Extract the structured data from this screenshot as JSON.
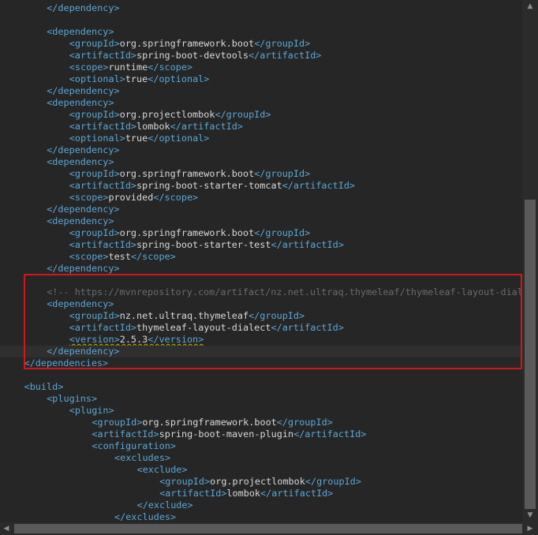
{
  "editor": {
    "lines": [
      {
        "indent": 2,
        "parts": [
          {
            "t": "tag",
            "v": "</dependency>"
          }
        ]
      },
      {
        "indent": 0,
        "parts": []
      },
      {
        "indent": 2,
        "parts": [
          {
            "t": "tag",
            "v": "<dependency>"
          }
        ]
      },
      {
        "indent": 3,
        "parts": [
          {
            "t": "tag",
            "v": "<groupId>"
          },
          {
            "t": "txt",
            "v": "org.springframework.boot"
          },
          {
            "t": "tag",
            "v": "</groupId>"
          }
        ]
      },
      {
        "indent": 3,
        "parts": [
          {
            "t": "tag",
            "v": "<artifactId>"
          },
          {
            "t": "txt",
            "v": "spring-boot-devtools"
          },
          {
            "t": "tag",
            "v": "</artifactId>"
          }
        ]
      },
      {
        "indent": 3,
        "parts": [
          {
            "t": "tag",
            "v": "<scope>"
          },
          {
            "t": "txt",
            "v": "runtime"
          },
          {
            "t": "tag",
            "v": "</scope>"
          }
        ]
      },
      {
        "indent": 3,
        "parts": [
          {
            "t": "tag",
            "v": "<optional>"
          },
          {
            "t": "txt",
            "v": "true"
          },
          {
            "t": "tag",
            "v": "</optional>"
          }
        ]
      },
      {
        "indent": 2,
        "parts": [
          {
            "t": "tag",
            "v": "</dependency>"
          }
        ]
      },
      {
        "indent": 2,
        "parts": [
          {
            "t": "tag",
            "v": "<dependency>"
          }
        ]
      },
      {
        "indent": 3,
        "parts": [
          {
            "t": "tag",
            "v": "<groupId>"
          },
          {
            "t": "txt",
            "v": "org.projectlombok"
          },
          {
            "t": "tag",
            "v": "</groupId>"
          }
        ]
      },
      {
        "indent": 3,
        "parts": [
          {
            "t": "tag",
            "v": "<artifactId>"
          },
          {
            "t": "txt",
            "v": "lombok"
          },
          {
            "t": "tag",
            "v": "</artifactId>"
          }
        ]
      },
      {
        "indent": 3,
        "parts": [
          {
            "t": "tag",
            "v": "<optional>"
          },
          {
            "t": "txt",
            "v": "true"
          },
          {
            "t": "tag",
            "v": "</optional>"
          }
        ]
      },
      {
        "indent": 2,
        "parts": [
          {
            "t": "tag",
            "v": "</dependency>"
          }
        ]
      },
      {
        "indent": 2,
        "parts": [
          {
            "t": "tag",
            "v": "<dependency>"
          }
        ]
      },
      {
        "indent": 3,
        "parts": [
          {
            "t": "tag",
            "v": "<groupId>"
          },
          {
            "t": "txt",
            "v": "org.springframework.boot"
          },
          {
            "t": "tag",
            "v": "</groupId>"
          }
        ]
      },
      {
        "indent": 3,
        "parts": [
          {
            "t": "tag",
            "v": "<artifactId>"
          },
          {
            "t": "txt",
            "v": "spring-boot-starter-tomcat"
          },
          {
            "t": "tag",
            "v": "</artifactId>"
          }
        ]
      },
      {
        "indent": 3,
        "parts": [
          {
            "t": "tag",
            "v": "<scope>"
          },
          {
            "t": "txt",
            "v": "provided"
          },
          {
            "t": "tag",
            "v": "</scope>"
          }
        ]
      },
      {
        "indent": 2,
        "parts": [
          {
            "t": "tag",
            "v": "</dependency>"
          }
        ]
      },
      {
        "indent": 2,
        "parts": [
          {
            "t": "tag",
            "v": "<dependency>"
          }
        ]
      },
      {
        "indent": 3,
        "parts": [
          {
            "t": "tag",
            "v": "<groupId>"
          },
          {
            "t": "txt",
            "v": "org.springframework.boot"
          },
          {
            "t": "tag",
            "v": "</groupId>"
          }
        ]
      },
      {
        "indent": 3,
        "parts": [
          {
            "t": "tag",
            "v": "<artifactId>"
          },
          {
            "t": "txt",
            "v": "spring-boot-starter-test"
          },
          {
            "t": "tag",
            "v": "</artifactId>"
          }
        ]
      },
      {
        "indent": 3,
        "parts": [
          {
            "t": "tag",
            "v": "<scope>"
          },
          {
            "t": "txt",
            "v": "test"
          },
          {
            "t": "tag",
            "v": "</scope>"
          }
        ]
      },
      {
        "indent": 2,
        "parts": [
          {
            "t": "tag",
            "v": "</dependency>"
          }
        ]
      },
      {
        "indent": 0,
        "parts": []
      },
      {
        "indent": 2,
        "parts": [
          {
            "t": "cmt",
            "v": "<!-- https://mvnrepository.com/artifact/nz.net.ultraq.thymeleaf/thymeleaf-layout-dialect -->"
          }
        ]
      },
      {
        "indent": 2,
        "parts": [
          {
            "t": "tag",
            "v": "<dependency>"
          }
        ]
      },
      {
        "indent": 3,
        "parts": [
          {
            "t": "tag",
            "v": "<groupId>"
          },
          {
            "t": "txt",
            "v": "nz.net.ultraq.thymeleaf"
          },
          {
            "t": "tag",
            "v": "</groupId>"
          }
        ]
      },
      {
        "indent": 3,
        "parts": [
          {
            "t": "tag",
            "v": "<artifactId>"
          },
          {
            "t": "txt",
            "v": "thymeleaf-layout-dialect"
          },
          {
            "t": "tag",
            "v": "</artifactId>"
          }
        ]
      },
      {
        "indent": 3,
        "squiggle": true,
        "parts": [
          {
            "t": "tag",
            "v": "<version>"
          },
          {
            "t": "txt",
            "v": "2.5.3"
          },
          {
            "t": "tag",
            "v": "</version>"
          }
        ]
      },
      {
        "indent": 2,
        "current": true,
        "parts": [
          {
            "t": "tag",
            "v": "</dependency>"
          }
        ]
      },
      {
        "indent": 1,
        "parts": [
          {
            "t": "tag",
            "v": "</dependencies>"
          }
        ]
      },
      {
        "indent": 0,
        "parts": []
      },
      {
        "indent": 1,
        "parts": [
          {
            "t": "tag",
            "v": "<build>"
          }
        ]
      },
      {
        "indent": 2,
        "parts": [
          {
            "t": "tag",
            "v": "<plugins>"
          }
        ]
      },
      {
        "indent": 3,
        "parts": [
          {
            "t": "tag",
            "v": "<plugin>"
          }
        ]
      },
      {
        "indent": 4,
        "parts": [
          {
            "t": "tag",
            "v": "<groupId>"
          },
          {
            "t": "txt",
            "v": "org.springframework.boot"
          },
          {
            "t": "tag",
            "v": "</groupId>"
          }
        ]
      },
      {
        "indent": 4,
        "parts": [
          {
            "t": "tag",
            "v": "<artifactId>"
          },
          {
            "t": "txt",
            "v": "spring-boot-maven-plugin"
          },
          {
            "t": "tag",
            "v": "</artifactId>"
          }
        ]
      },
      {
        "indent": 4,
        "parts": [
          {
            "t": "tag",
            "v": "<configuration>"
          }
        ]
      },
      {
        "indent": 5,
        "parts": [
          {
            "t": "tag",
            "v": "<excludes>"
          }
        ]
      },
      {
        "indent": 6,
        "parts": [
          {
            "t": "tag",
            "v": "<exclude>"
          }
        ]
      },
      {
        "indent": 7,
        "parts": [
          {
            "t": "tag",
            "v": "<groupId>"
          },
          {
            "t": "txt",
            "v": "org.projectlombok"
          },
          {
            "t": "tag",
            "v": "</groupId>"
          }
        ]
      },
      {
        "indent": 7,
        "parts": [
          {
            "t": "tag",
            "v": "<artifactId>"
          },
          {
            "t": "txt",
            "v": "lombok"
          },
          {
            "t": "tag",
            "v": "</artifactId>"
          }
        ]
      },
      {
        "indent": 6,
        "parts": [
          {
            "t": "tag",
            "v": "</exclude>"
          }
        ]
      },
      {
        "indent": 5,
        "parts": [
          {
            "t": "tag",
            "v": "</excludes>"
          }
        ]
      }
    ]
  },
  "scrollbars": {
    "up_arrow": "▲",
    "down_arrow": "▼",
    "left_arrow": "◀",
    "right_arrow": "▶"
  },
  "colors": {
    "tag": "#5aa7d8",
    "text": "#d8d8d8",
    "comment": "#6a6a6a",
    "highlight_border": "#d01818",
    "background": "#262626"
  }
}
